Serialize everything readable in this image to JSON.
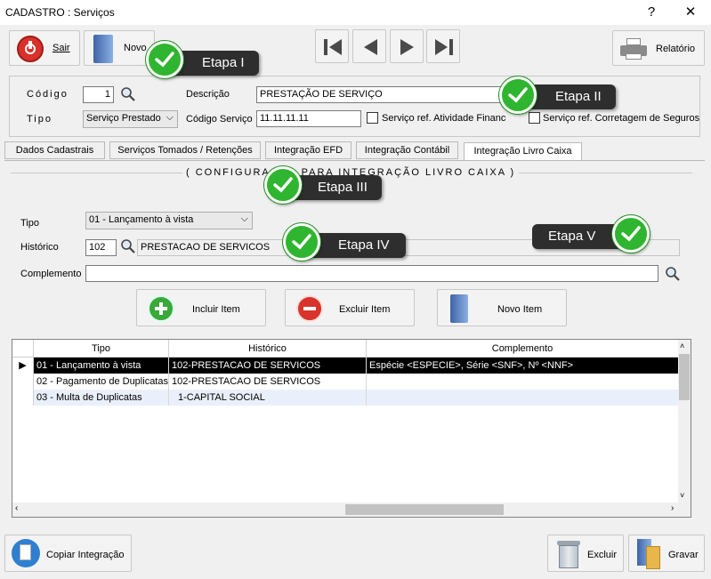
{
  "window": {
    "title": "CADASTRO : Serviços",
    "help": "?",
    "close": "✕"
  },
  "toolbar": {
    "sair": "Sair",
    "novo": "Novo",
    "relatorio": "Relatório"
  },
  "form": {
    "codigo_label": "Código",
    "codigo_value": "1",
    "descricao_label": "Descrição",
    "descricao_value": "PRESTAÇÃO DE SERVIÇO",
    "tipo_label": "Tipo",
    "tipo_value": "Serviço Prestado",
    "codigo_servico_label": "Código Serviço",
    "codigo_servico_value": "11.11.11.11",
    "check_atividade": "Serviço ref. Atividade Financeira",
    "check_corretagem": "Serviço ref. Corretagem de Seguros"
  },
  "tabs": [
    "Dados Cadastrais",
    "Serviços Tomados / Retenções",
    "Integração EFD",
    "Integração Contábil",
    "Integração Livro Caixa"
  ],
  "group": {
    "title": "( CONFIGURAÇÃO PARA INTEGRAÇÃO LIVRO CAIXA )",
    "tipo_label": "Tipo",
    "tipo_value": "01 - Lançamento à vista",
    "historico_label": "Histórico",
    "historico_code": "102",
    "historico_desc": "PRESTACAO DE SERVICOS",
    "complemento_label": "Complemento",
    "complemento_value": ""
  },
  "actions": {
    "incluir": "Incluir Item",
    "excluir": "Excluir Item",
    "novo": "Novo Item"
  },
  "grid": {
    "columns": [
      "Tipo",
      "Histórico",
      "Complemento"
    ],
    "rows": [
      {
        "tipo": "01 - Lançamento à vista",
        "historico": "102-PRESTACAO DE SERVICOS",
        "complemento": "Espécie <ESPECIE>, Série <SNF>, Nº <NNF>"
      },
      {
        "tipo": "02 - Pagamento de Duplicatas",
        "historico": "102-PRESTACAO DE SERVICOS",
        "complemento": ""
      },
      {
        "tipo": "03 - Multa de Duplicatas",
        "historico": "1-CAPITAL SOCIAL",
        "complemento": ""
      }
    ]
  },
  "footer": {
    "copiar": "Copiar Integração",
    "excluir": "Excluir",
    "gravar": "Gravar"
  },
  "callouts": {
    "etapa1": "Etapa I",
    "etapa2": "Etapa II",
    "etapa3": "Etapa III",
    "etapa4": "Etapa IV",
    "etapa5": "Etapa V"
  },
  "colors": {
    "callout_bg": "#2e2e2e",
    "check_green": "#2fb52f",
    "selected_row": "#000000",
    "alt_row": "#eaf0fb"
  }
}
